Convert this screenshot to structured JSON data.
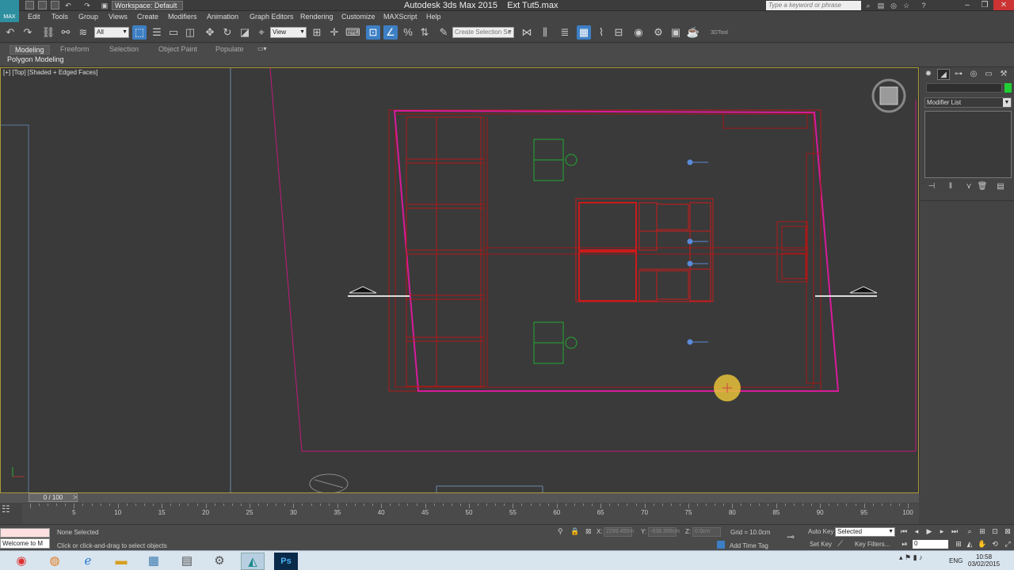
{
  "title_bar": {
    "logo": "MAX",
    "workspace": "Workspace: Default",
    "app_title": "Autodesk 3ds Max  2015",
    "file_name": "Ext Tut5.max",
    "search_placeholder": "Type a keyword or phrase"
  },
  "menu": [
    "Edit",
    "Tools",
    "Group",
    "Views",
    "Create",
    "Modifiers",
    "Animation",
    "Graph Editors",
    "Rendering",
    "Customize",
    "MAXScript",
    "Help"
  ],
  "toolbar": {
    "selection_filter": "All",
    "ref_coord": "View",
    "named_selection": "Create Selection Se",
    "extra_label": "3DTool"
  },
  "ribbon": {
    "tabs": [
      "Modeling",
      "Freeform",
      "Selection",
      "Object Paint",
      "Populate"
    ],
    "active_tab": "Modeling",
    "sub_label": "Polygon Modeling"
  },
  "viewport": {
    "label": "[+] [Top] [Shaded + Edged Faces]"
  },
  "command_panel": {
    "modifier_list": "Modifier List",
    "color_swatch": "#22cc33"
  },
  "timeline": {
    "slider_label": "0 / 100",
    "ticks": [
      5,
      10,
      15,
      20,
      25,
      30,
      35,
      40,
      45,
      50,
      55,
      60,
      65,
      70,
      75,
      80,
      85,
      90,
      95,
      100
    ]
  },
  "status": {
    "selection": "None Selected",
    "prompt": "Click or click-and-drag to select objects",
    "maxscript": "Welcome to M",
    "x_label": "X:",
    "x_value": "2299.455m",
    "y_label": "Y:",
    "y_value": "-638.356cm",
    "z_label": "Z:",
    "z_value": "0.0cm",
    "grid": "Grid = 10.0cm",
    "add_time_tag": "Add Time Tag",
    "auto_key": "Auto Key",
    "set_key": "Set Key",
    "selected_dropdown": "Selected",
    "key_filters": "Key Filters...",
    "frame": "0"
  },
  "taskbar": {
    "apps": [
      "chrome-icon",
      "firefox-icon",
      "ie-icon",
      "explorer-icon",
      "network-icon",
      "tools-icon",
      "settings-icon",
      "3dsmax-icon",
      "photoshop-icon"
    ],
    "ps_label": "Ps",
    "language": "ENG",
    "time": "10:58",
    "date": "03/02/2015"
  },
  "colors": {
    "accent": "#3d7fc4",
    "viewport_bg": "#3a3a3a",
    "wire_red": "#cc1a1a",
    "wire_magenta": "#d81a9a",
    "wire_green": "#22aa33",
    "cursor": "#e8c23a"
  }
}
